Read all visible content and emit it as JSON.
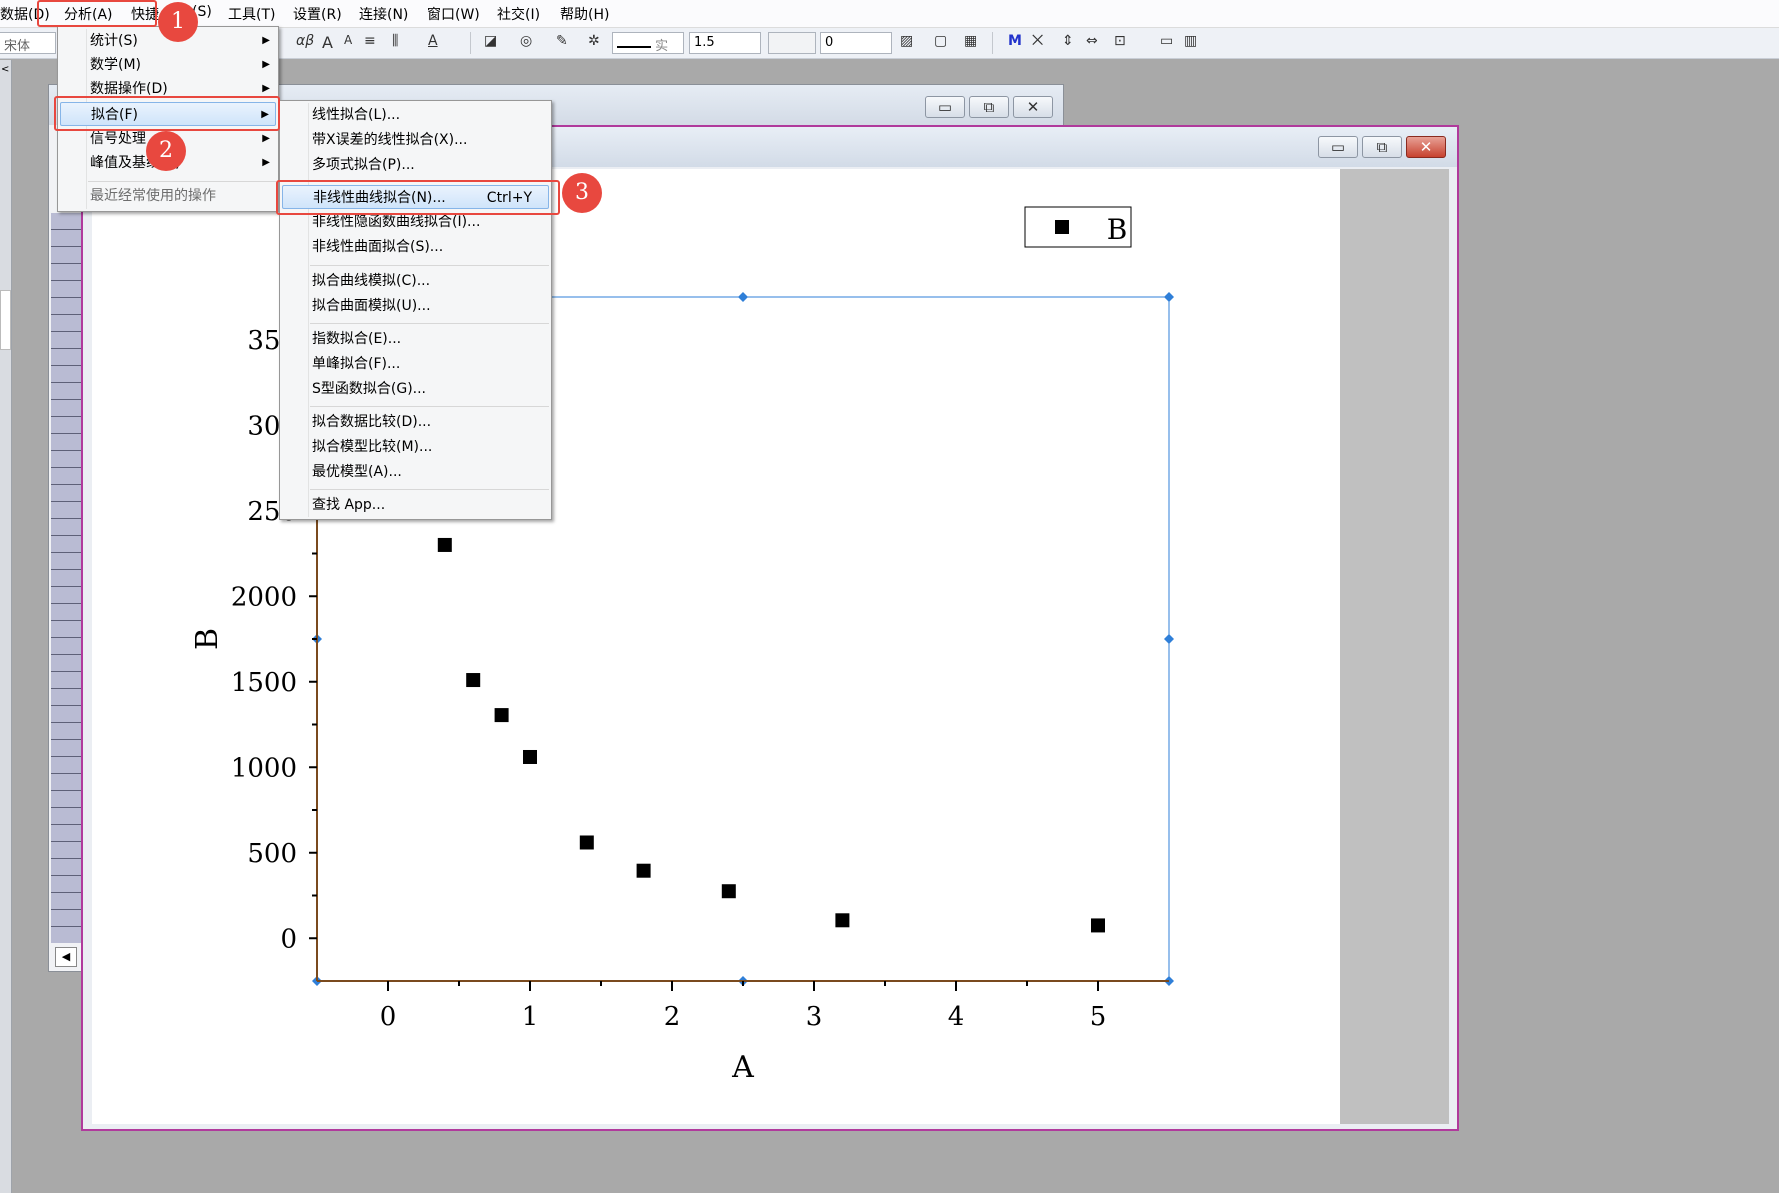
{
  "menubar": {
    "items": [
      "数据(D)",
      "分析(A)",
      "快捷",
      "(S)",
      "工具(T)",
      "设置(R)",
      "连接(N)",
      "窗口(W)",
      "社交(I)",
      "帮助(H)"
    ]
  },
  "toolbar": {
    "font_name": "宋体",
    "greek_glyph": "αβ",
    "font_a": "A",
    "line_style": "实",
    "line_width": "1.5",
    "value_zero": "0"
  },
  "window": {
    "minimize_glyph": "▭",
    "maximize_glyph": "⧉",
    "close_glyph": "✕",
    "scroll_left_glyph": "◀",
    "left_strip_glyph": "<"
  },
  "analysis_menu": {
    "items": [
      {
        "label": "统计(S)",
        "arrow": "▶"
      },
      {
        "label": "数学(M)",
        "arrow": "▶"
      },
      {
        "label": "数据操作(D)",
        "arrow": "▶"
      },
      {
        "label": "拟合(F)",
        "arrow": "▶"
      },
      {
        "label": "信号处理",
        "arrow": "▶"
      },
      {
        "label": "峰值及基线(B)",
        "arrow": "▶"
      },
      {
        "label": "最近经常使用的操作",
        "arrow": ""
      }
    ]
  },
  "fitting_menu": {
    "items": [
      {
        "label": "线性拟合(L)...",
        "shortcut": ""
      },
      {
        "label": "带X误差的线性拟合(X)...",
        "shortcut": ""
      },
      {
        "label": "多项式拟合(P)...",
        "shortcut": ""
      },
      {
        "label": "非线性曲线拟合(N)...",
        "shortcut": "Ctrl+Y"
      },
      {
        "label": "非线性隐函数曲线拟合(I)...",
        "shortcut": ""
      },
      {
        "label": "非线性曲面拟合(S)...",
        "shortcut": ""
      },
      {
        "label": "拟合曲线模拟(C)...",
        "shortcut": ""
      },
      {
        "label": "拟合曲面模拟(U)...",
        "shortcut": ""
      },
      {
        "label": "指数拟合(E)...",
        "shortcut": ""
      },
      {
        "label": "单峰拟合(F)...",
        "shortcut": ""
      },
      {
        "label": "S型函数拟合(G)...",
        "shortcut": ""
      },
      {
        "label": "拟合数据比较(D)...",
        "shortcut": ""
      },
      {
        "label": "拟合模型比较(M)...",
        "shortcut": ""
      },
      {
        "label": "最优模型(A)...",
        "shortcut": ""
      },
      {
        "label": "查找 App...",
        "shortcut": ""
      }
    ]
  },
  "annotations": {
    "badges": [
      "1",
      "2",
      "3"
    ]
  },
  "chart_data": {
    "type": "scatter",
    "xlabel": "A",
    "ylabel": "B",
    "x_ticks": [
      "0",
      "1",
      "2",
      "3",
      "4",
      "5"
    ],
    "y_ticks": [
      "0",
      "500",
      "1000",
      "1500",
      "2000",
      "250",
      "300",
      "350"
    ],
    "xlim": [
      -0.5,
      5.5
    ],
    "ylim": [
      -250,
      3750
    ],
    "legend": {
      "label": "B",
      "position": "top-right"
    },
    "marker_color": "#000000",
    "axis_color": "#7a4a1e",
    "frame_color": "#2f7fd8",
    "series": [
      {
        "name": "B",
        "x": [
          0.4,
          0.6,
          0.8,
          1.0,
          1.4,
          1.8,
          2.4,
          3.2,
          5.0
        ],
        "y": [
          2300,
          1510,
          1305,
          1060,
          560,
          395,
          275,
          105,
          75
        ]
      }
    ]
  }
}
